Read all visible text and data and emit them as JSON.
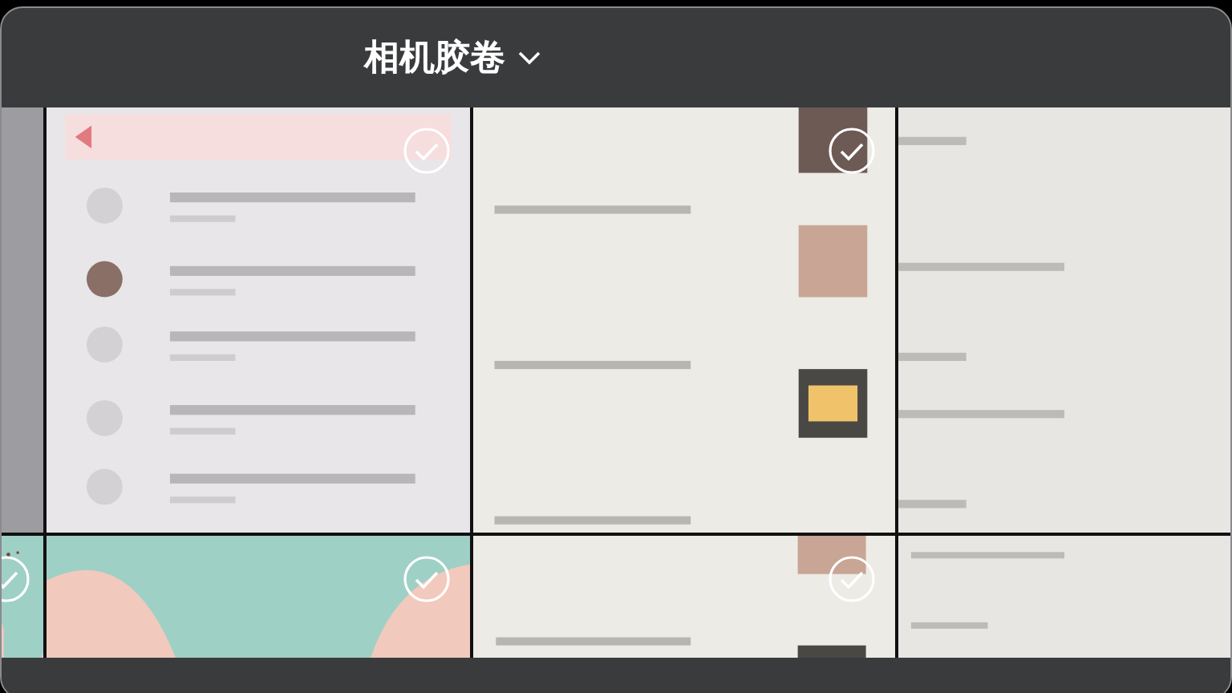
{
  "header": {
    "title": "相机胶卷"
  },
  "tiles": [
    {
      "kind": "plain"
    },
    {
      "kind": "selectable",
      "selected": false
    },
    {
      "kind": "selectable",
      "selected": false
    },
    {
      "kind": "plain"
    },
    {
      "kind": "selectable",
      "selected": false
    },
    {
      "kind": "selectable",
      "selected": false
    },
    {
      "kind": "selectable",
      "selected": false
    },
    {
      "kind": "plain"
    }
  ]
}
